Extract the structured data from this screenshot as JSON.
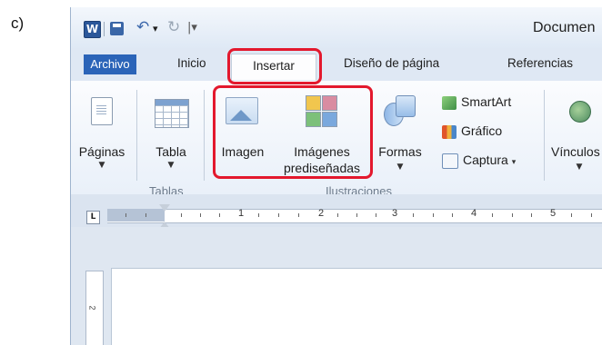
{
  "figure_label": "c)",
  "window": {
    "title": "Documen",
    "qat": {
      "app_icon_letter": "W",
      "undo_glyph": "↶",
      "dropdown_glyph": "▾",
      "redo_glyph": "↻",
      "customize_glyph": "|▾"
    }
  },
  "tabs": [
    "Archivo",
    "Inicio",
    "Insertar",
    "Diseño de página",
    "Referencias"
  ],
  "ribbon": {
    "paginas": {
      "label": "Páginas",
      "dropdown": "▼"
    },
    "tabla": {
      "label": "Tabla",
      "dropdown": "▼",
      "group": "Tablas"
    },
    "imagen": {
      "label": "Imagen"
    },
    "imagenes_prediseñadas": {
      "line1": "Imágenes",
      "line2": "prediseñadas"
    },
    "formas": {
      "label": "Formas",
      "dropdown": "▼"
    },
    "smartart": {
      "label": "SmartArt"
    },
    "grafico": {
      "label": "Gráfico"
    },
    "captura": {
      "label": "Captura",
      "dropdown": "▾"
    },
    "ilustraciones_group": "Ilustraciones",
    "vinculos": {
      "label": "Vínculos",
      "dropdown": "▼"
    }
  },
  "ruler": {
    "corner_glyph": "L",
    "numbers": [
      "1",
      "2",
      "3",
      "4",
      "5"
    ],
    "vertical_number": "2"
  },
  "colors": {
    "highlight": "#e3182d",
    "archivo_tab": "#2b64b8",
    "word_blue": "#2b579a"
  },
  "highlighted": [
    "tab-insertar",
    "insert-image-group"
  ]
}
